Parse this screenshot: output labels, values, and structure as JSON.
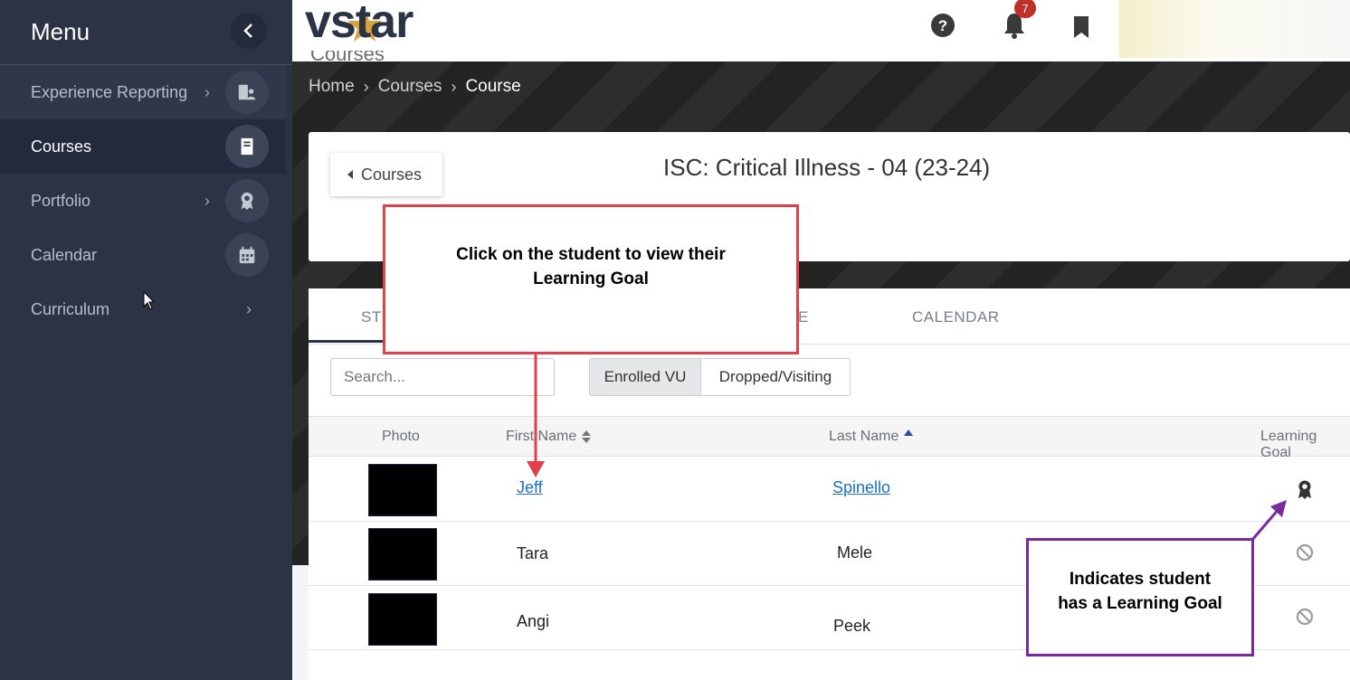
{
  "sidebar": {
    "title": "Menu",
    "collapse_icon": "chevron-left-icon",
    "items": [
      {
        "label": "Experience Reporting",
        "icon": "id-card-icon",
        "has_children": true
      },
      {
        "label": "Courses",
        "icon": "book-icon",
        "active": true
      },
      {
        "label": "Portfolio",
        "icon": "award-icon",
        "has_children": true
      },
      {
        "label": "Calendar",
        "icon": "calendar-icon"
      },
      {
        "label": "Curriculum",
        "has_children": true
      }
    ]
  },
  "topbar": {
    "logo": "vstar",
    "notification_count": "7"
  },
  "banner": {
    "partial_title": "Courses",
    "breadcrumb": [
      "Home",
      "Courses",
      "Course"
    ]
  },
  "course": {
    "back_label": "Courses",
    "title": "ISC: Critical Illness - 04 (23-24)"
  },
  "tabs": [
    "ST",
    "E",
    "CALENDAR"
  ],
  "filters": {
    "search_placeholder": "Search...",
    "enrolled_label": "Enrolled VU",
    "dropped_label": "Dropped/Visiting"
  },
  "table": {
    "headers": {
      "photo": "Photo",
      "first_name": "First Name",
      "last_name": "Last Name",
      "learning_goal": "Learning Goal"
    },
    "rows": [
      {
        "first": "Jeff",
        "last": "Spinello",
        "learning_goal": true
      },
      {
        "first": "Tara",
        "last": "Mele",
        "learning_goal": false
      },
      {
        "first": "Angi",
        "last": "Peek",
        "learning_goal": false
      }
    ]
  },
  "annotations": {
    "red_line1": "Click on the student to view their",
    "red_line2": "Learning Goal",
    "purple_line1": "Indicates student",
    "purple_line2": "has a Learning Goal"
  },
  "colors": {
    "sidebar_bg": "#2b3345",
    "link": "#1a6fcf",
    "badge": "#c0302a",
    "callout_red": "#e0404a",
    "callout_purple": "#7b2a9b"
  }
}
